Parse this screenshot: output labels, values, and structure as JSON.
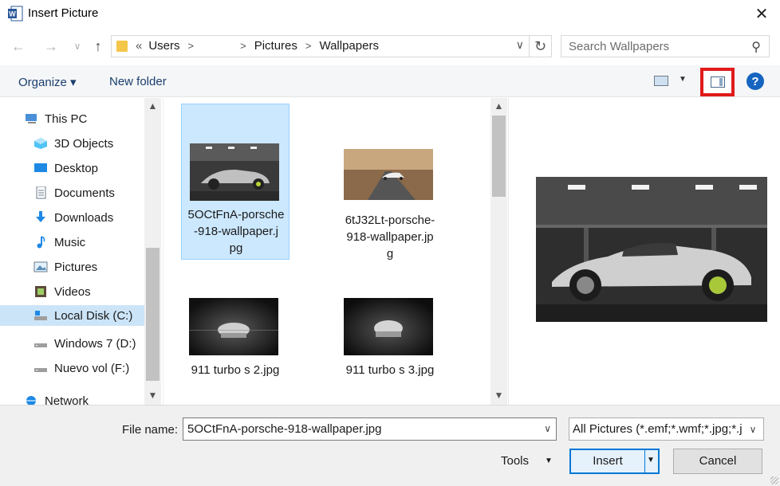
{
  "window": {
    "title": "Insert Picture",
    "close_glyph": "✕"
  },
  "nav": {
    "back_glyph": "←",
    "forward_glyph": "→",
    "recent_glyph": "∨",
    "up_glyph": "↑",
    "breadcrumb_overflow": "«",
    "breadcrumbs": [
      "Users",
      "",
      "Pictures",
      "Wallpapers"
    ],
    "refresh_glyph": "↻",
    "search_placeholder": "Search Wallpapers"
  },
  "toolbar": {
    "organize_label": "Organize ▾",
    "new_folder_label": "New folder",
    "help_label": "?"
  },
  "sidebar": {
    "items": [
      {
        "label": "This PC",
        "icon": "pc-icon"
      },
      {
        "label": "3D Objects",
        "icon": "3d-objects-icon"
      },
      {
        "label": "Desktop",
        "icon": "desktop-icon"
      },
      {
        "label": "Documents",
        "icon": "documents-icon"
      },
      {
        "label": "Downloads",
        "icon": "downloads-icon"
      },
      {
        "label": "Music",
        "icon": "music-icon"
      },
      {
        "label": "Pictures",
        "icon": "pictures-icon"
      },
      {
        "label": "Videos",
        "icon": "videos-icon"
      },
      {
        "label": "Local Disk (C:)",
        "icon": "local-disk-icon"
      },
      {
        "label": "Windows 7 (D:)",
        "icon": "drive-icon"
      },
      {
        "label": "Nuevo vol (F:)",
        "icon": "drive-icon"
      },
      {
        "label": "Network",
        "icon": "network-icon"
      }
    ],
    "selected_index": 8
  },
  "files": [
    {
      "name_lines": [
        "5OCtFnA-porsche",
        "-918-wallpaper.j",
        "pg"
      ],
      "selected": true
    },
    {
      "name_lines": [
        "6tJ32Lt-porsche-",
        "918-wallpaper.jp",
        "g"
      ],
      "selected": false
    },
    {
      "name_lines": [
        "911 turbo s 2.jpg"
      ],
      "selected": false
    },
    {
      "name_lines": [
        "911 turbo s 3.jpg"
      ],
      "selected": false
    }
  ],
  "bottom": {
    "file_name_label": "File name:",
    "file_name_value": "5OCtFnA-porsche-918-wallpaper.jpg",
    "filter_value": "All Pictures (*.emf;*.wmf;*.jpg;*.j",
    "tools_label": "Tools",
    "insert_label": "Insert",
    "cancel_label": "Cancel"
  },
  "colors": {
    "accent": "#0078d7",
    "highlight_red": "#e01b1b",
    "selection": "#cce8ff"
  }
}
